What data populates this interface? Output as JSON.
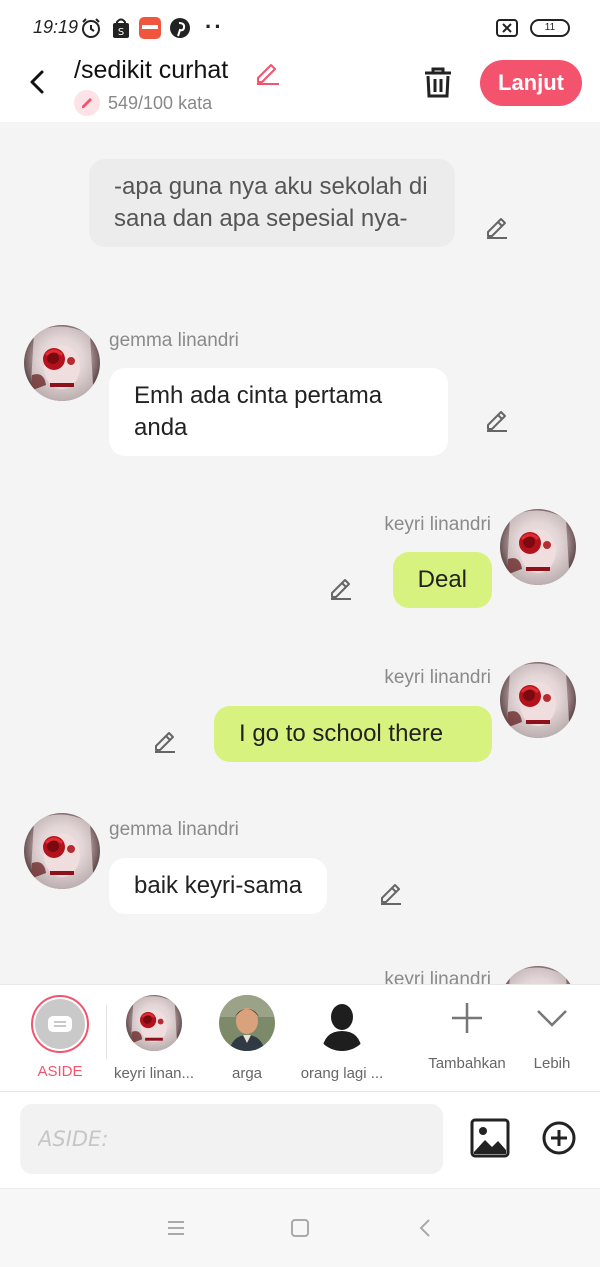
{
  "status_bar": {
    "time": "19:19",
    "battery": "11"
  },
  "header": {
    "title": "/sedikit curhat",
    "word_count": "549/100 kata",
    "next_button": "Lanjut"
  },
  "messages": [
    {
      "type": "narration",
      "text": "-apa guna nya aku sekolah di sana dan apa sepesial nya-"
    },
    {
      "type": "left",
      "name": "gemma linandri",
      "text": "Emh ada cinta pertama anda"
    },
    {
      "type": "right",
      "name": "keyri linandri",
      "text": "Deal"
    },
    {
      "type": "right",
      "name": "keyri linandri",
      "text": "I go to school there"
    },
    {
      "type": "left",
      "name": "gemma linandri",
      "text": "baik keyri-sama"
    },
    {
      "type": "right",
      "name": "keyri linandri",
      "text": ""
    }
  ],
  "characters": [
    {
      "label": "ASIDE",
      "selected": true
    },
    {
      "label": "keyri linan..."
    },
    {
      "label": "arga"
    },
    {
      "label": "orang lagi ..."
    },
    {
      "label": "Tambahkan"
    },
    {
      "label": "Lebih"
    }
  ],
  "input": {
    "placeholder": "ASIDE:"
  },
  "colors": {
    "accent": "#f4536e",
    "bubble_right": "#d7f27e",
    "bubble_left": "#ffffff",
    "narration": "#ececec"
  },
  "icons": {
    "back": "chevron-left-icon",
    "edit": "pencil-icon",
    "delete": "trash-icon",
    "add": "plus-icon",
    "more": "chevron-down-icon",
    "image": "image-icon",
    "add_circle": "plus-circle-icon",
    "menu": "menu-icon",
    "home": "square-icon",
    "nav_back": "nav-back-icon"
  }
}
